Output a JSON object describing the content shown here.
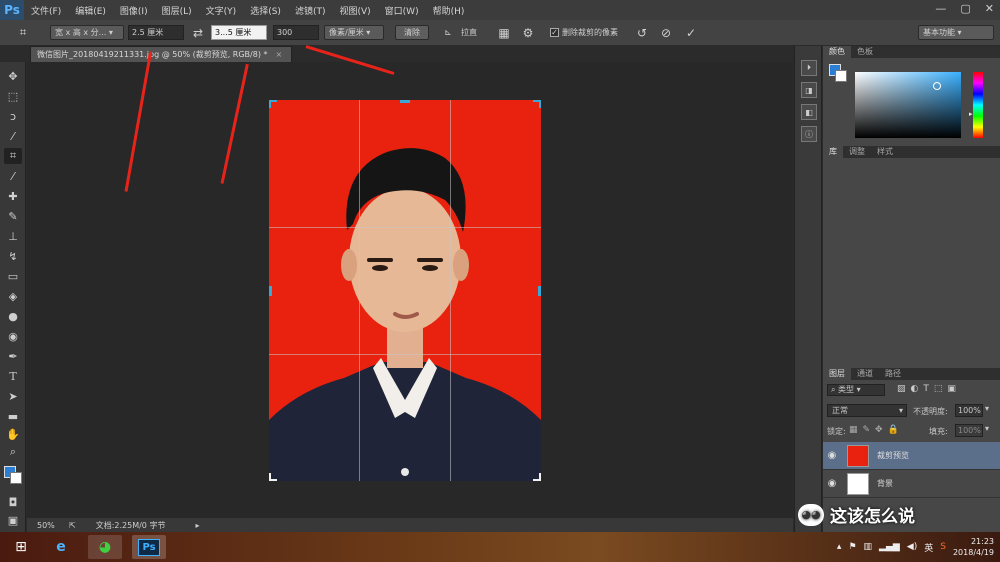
{
  "app": {
    "logo": "Ps",
    "menus": [
      "文件(F)",
      "编辑(E)",
      "图像(I)",
      "图层(L)",
      "文字(Y)",
      "选择(S)",
      "滤镜(T)",
      "视图(V)",
      "窗口(W)",
      "帮助(H)"
    ],
    "window_controls": [
      "—",
      "▢",
      "✕"
    ]
  },
  "options_bar": {
    "ratio_dropdown": "宽 x 高 x 分...",
    "width_value": "2.5 厘米",
    "height_value": "3...5 厘米",
    "resolution_value": "300",
    "unit_dropdown": "像素/厘米",
    "clear_button": "清除",
    "straighten_label": "拉直",
    "delete_cropped_label": "删除裁剪的像素",
    "delete_cropped_checked": true,
    "workspace_dropdown": "基本功能"
  },
  "document": {
    "tab_title": "微信图片_20180419211331.jpg @ 50% (裁剪预览, RGB/8) *",
    "close_glyph": "×"
  },
  "status": {
    "zoom": "50%",
    "doc_size": "文档:2.25M/0 字节"
  },
  "panels": {
    "color_tabs": [
      "颜色",
      "色板"
    ],
    "library_tabs": [
      "库",
      "调整",
      "样式"
    ],
    "layer_tabs": [
      "图层",
      "通道",
      "路径"
    ],
    "filter_kind": "类型",
    "blend_mode": "正常",
    "opacity_label": "不透明度:",
    "opacity_value": "100%",
    "lock_label": "锁定:",
    "fill_label": "填充:",
    "fill_value": "100%",
    "layers": [
      {
        "name": "裁剪预览",
        "selected": true
      },
      {
        "name": "背景",
        "selected": false
      }
    ]
  },
  "taskbar": {
    "ime": "英",
    "time": "21:23",
    "date": "2018/4/19"
  },
  "watermark": {
    "text": "这该怎么说"
  },
  "colors": {
    "photo_background": "#e8220f",
    "foreground_swatch": "#2a7fd4",
    "selected_layer": "#5c6f8a",
    "annotation": "#e8231a"
  }
}
